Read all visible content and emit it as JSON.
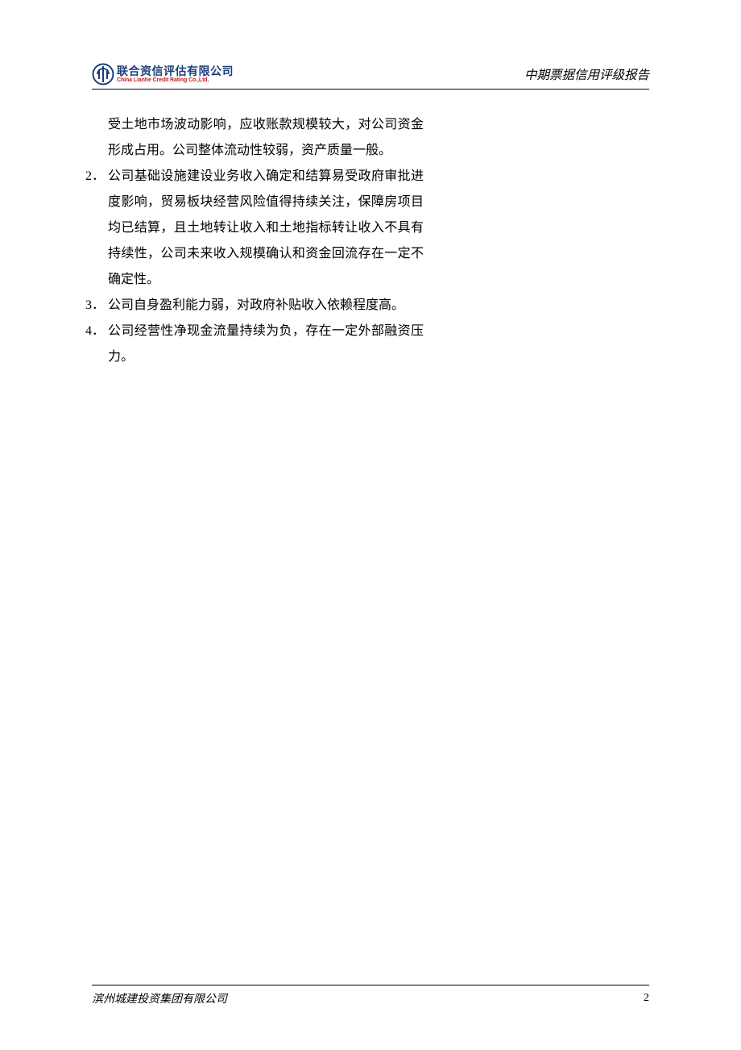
{
  "header": {
    "logo_cn": "联合资信评估有限公司",
    "logo_en": "China Lianhe Credit Rating Co.,Ltd.",
    "title": "中期票据信用评级报告"
  },
  "content": {
    "continuation": "受土地市场波动影响，应收账款规模较大，对公司资金形成占用。公司整体流动性较弱，资产质量一般。",
    "items": [
      {
        "num": "2．",
        "text": "公司基础设施建设业务收入确定和结算易受政府审批进度影响，贸易板块经营风险值得持续关注，保障房项目均已结算，且土地转让收入和土地指标转让收入不具有持续性，公司未来收入规模确认和资金回流存在一定不确定性。"
      },
      {
        "num": "3．",
        "text": "公司自身盈利能力弱，对政府补贴收入依赖程度高。"
      },
      {
        "num": "4．",
        "text": "公司经营性净现金流量持续为负，存在一定外部融资压力。"
      }
    ]
  },
  "footer": {
    "company": "滨州城建投资集团有限公司",
    "page": "2"
  }
}
